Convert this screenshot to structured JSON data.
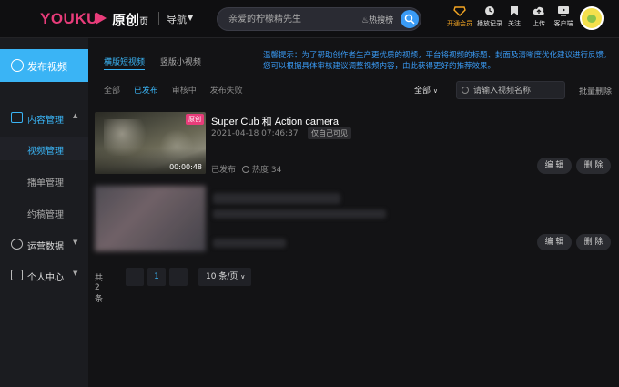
{
  "header": {
    "logo_text": "YOUKU",
    "logo_sub": "原创",
    "logo_sub2": "页",
    "nav_label": "导航",
    "search_placeholder": "亲爱的柠檬精先生",
    "hot_label": "热搜榜",
    "icons": [
      {
        "name": "vip-icon",
        "label": "开通会员",
        "color": "#f5a623"
      },
      {
        "name": "history-icon",
        "label": "播放记录"
      },
      {
        "name": "follow-icon",
        "label": "关注"
      },
      {
        "name": "upload-icon",
        "label": "上传"
      },
      {
        "name": "client-icon",
        "label": "客户端"
      }
    ]
  },
  "sidebar": {
    "publish_label": "发布视频",
    "groups": [
      {
        "label": "内容管理",
        "icon": "content-icon",
        "active": true
      },
      {
        "label": "运营数据",
        "icon": "chart-icon"
      },
      {
        "label": "个人中心",
        "icon": "grid-icon"
      }
    ],
    "sub_items": [
      {
        "label": "视频管理",
        "active": true
      },
      {
        "label": "播单管理"
      },
      {
        "label": "约稿管理"
      }
    ]
  },
  "main": {
    "tabs": [
      {
        "label": "横版短视频",
        "active": true
      },
      {
        "label": "竖版小视频"
      }
    ],
    "notice": "温馨提示：为了帮助创作者生产更优质的视频，平台将视频的标题、封面及清晰度优化建议进行反馈。您可以根据具体审核建议调整视频内容，由此获得更好的推荐效果。",
    "filters": [
      {
        "label": "全部"
      },
      {
        "label": "已发布",
        "active": true
      },
      {
        "label": "审核中"
      },
      {
        "label": "发布失败"
      }
    ],
    "all_select": "全部",
    "video_search_placeholder": "请输入视频名称",
    "batch_delete": "批量删除",
    "videos": [
      {
        "badge": "原创",
        "duration": "00:00:48",
        "title": "Super Cub 和 Action camera",
        "date": "2021-04-18 07:46:37",
        "visibility": "仅自己可见",
        "status": "已发布",
        "heat": "热度 34",
        "edit": "编 辑",
        "delete": "删 除"
      },
      {
        "edit": "编 辑",
        "delete": "删 除"
      }
    ],
    "pagination": {
      "total": "共 2 条",
      "current": "1",
      "page_size": "10 条/页"
    }
  },
  "colors": {
    "accent": "#3ab4f5",
    "brand": "#e83c7a"
  }
}
